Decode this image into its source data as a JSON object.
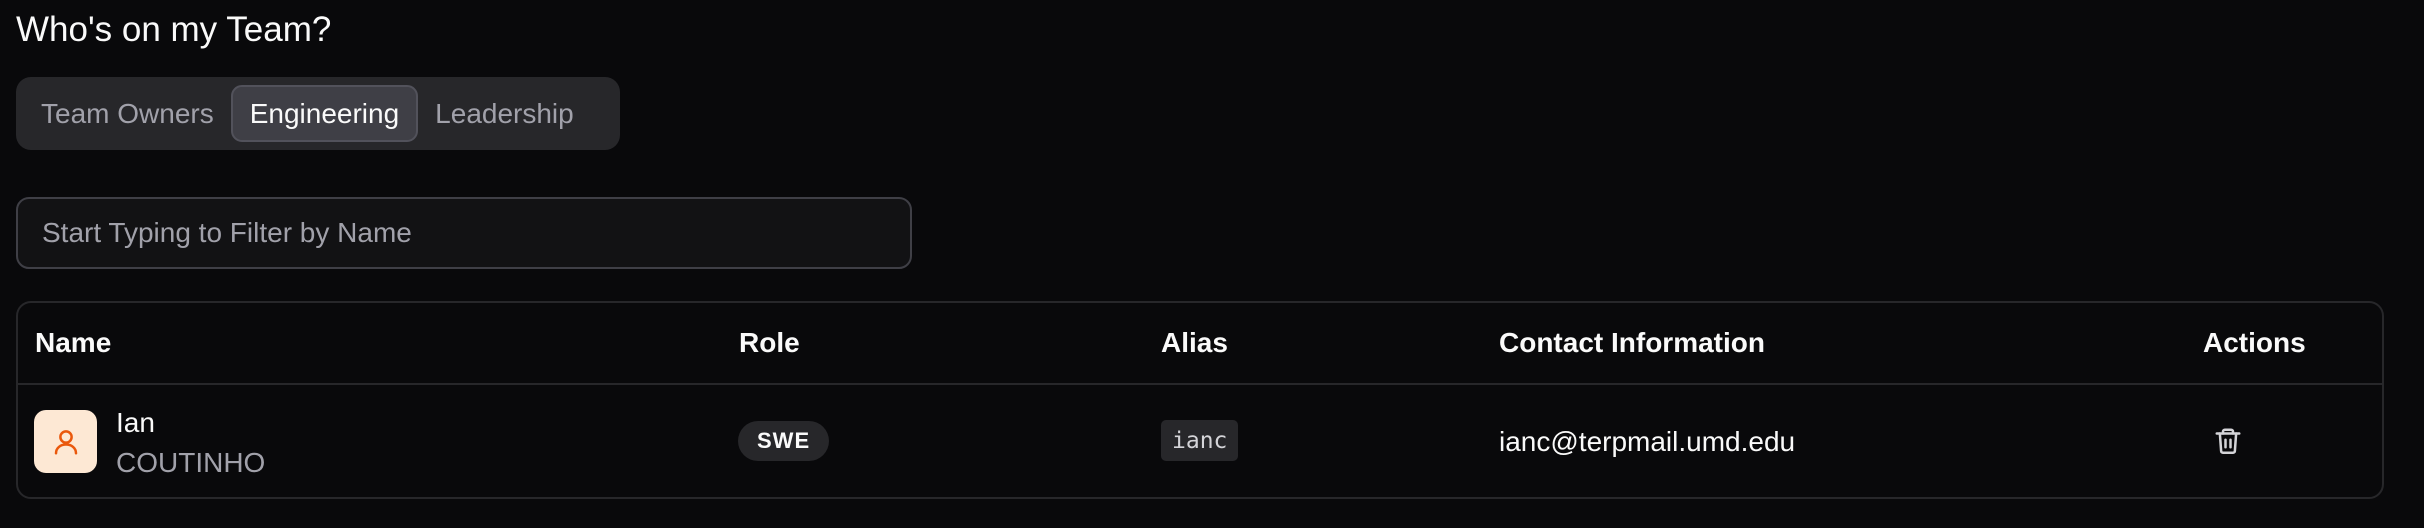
{
  "page": {
    "title": "Who's on my Team?"
  },
  "tabs": [
    {
      "label": "Team Owners",
      "active": false
    },
    {
      "label": "Engineering",
      "active": true
    },
    {
      "label": "Leadership",
      "active": false
    }
  ],
  "filter": {
    "placeholder": "Start Typing to Filter by Name",
    "value": ""
  },
  "table": {
    "columns": [
      "Name",
      "Role",
      "Alias",
      "Contact Information",
      "Actions"
    ],
    "rows": [
      {
        "first_name": "Ian",
        "last_name": "COUTINHO",
        "avatar_icon": "user-icon",
        "role": "SWE",
        "alias": "ianc",
        "contact": "ianc@terpmail.umd.edu",
        "action_icon": "trash-icon"
      }
    ]
  },
  "colors": {
    "background": "#09090b",
    "avatar_bg": "#fde8d4",
    "avatar_icon": "#ea580c",
    "muted_text": "#a1a1aa"
  }
}
